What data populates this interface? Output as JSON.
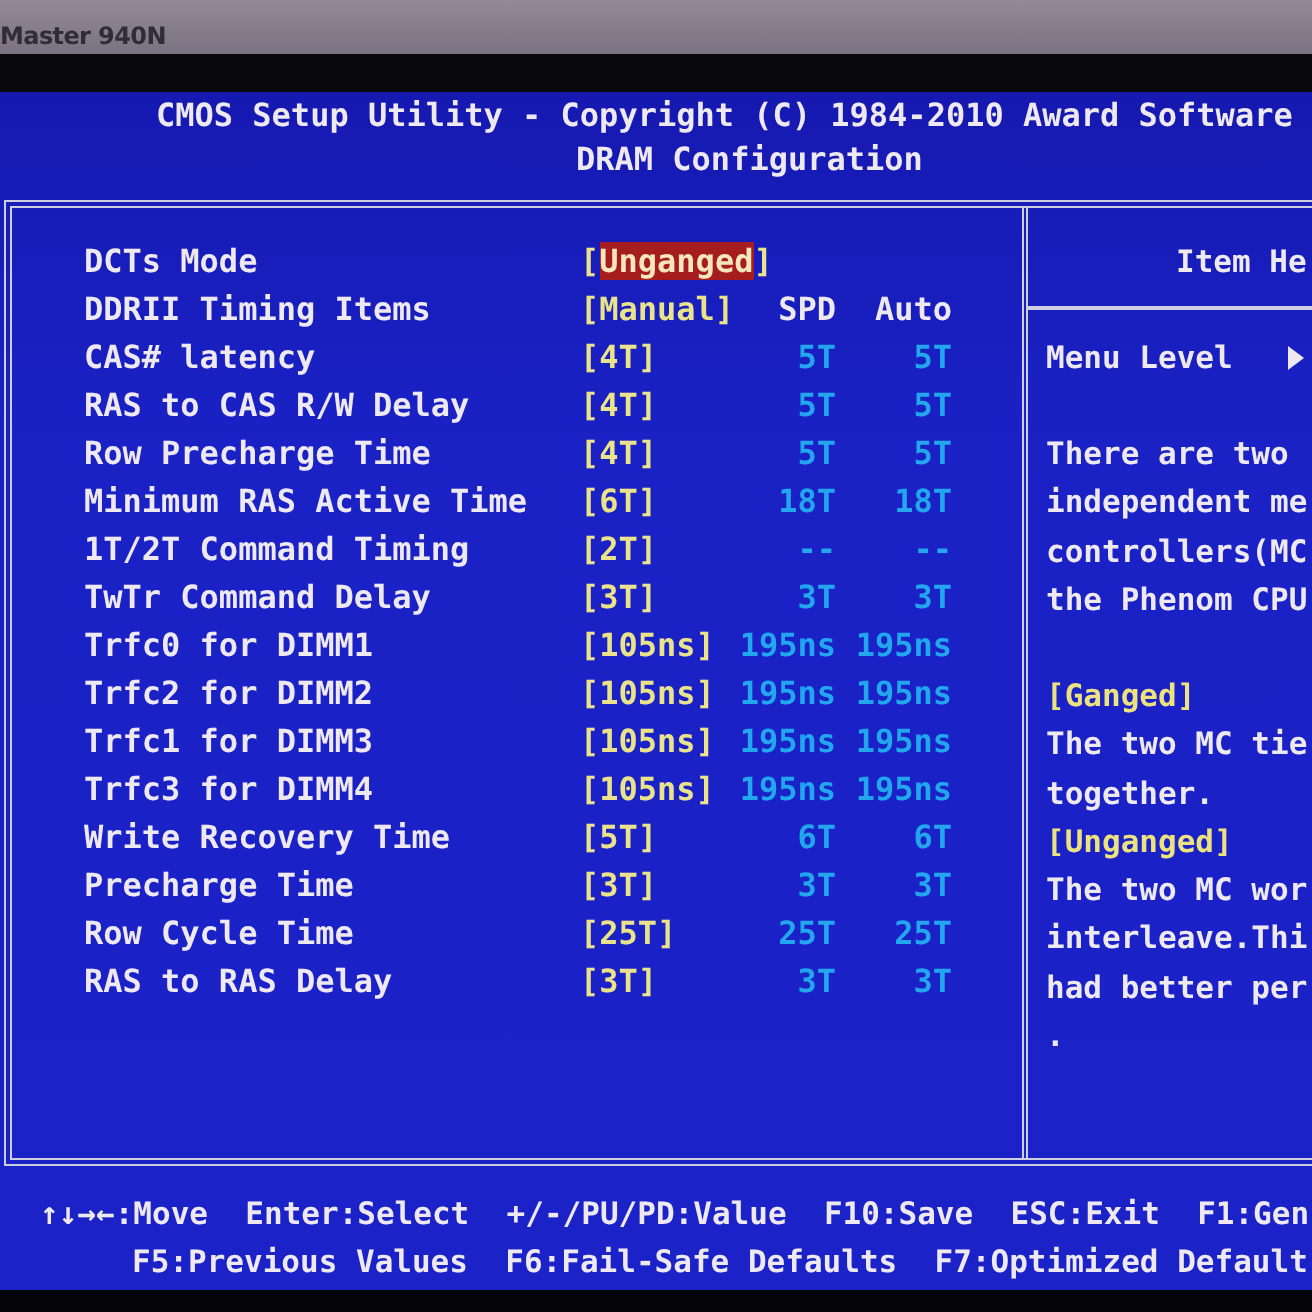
{
  "bezel": {
    "label": "Master 940N"
  },
  "header": {
    "title": "CMOS Setup Utility - Copyright (C) 1984-2010 Award Software",
    "subtitle": "DRAM Configuration"
  },
  "rows": [
    {
      "kind": "option",
      "label": "DCTs Mode",
      "value": "[Unganged]",
      "selected": true
    },
    {
      "kind": "heading",
      "label": "DDRII Timing Items",
      "value": "[Manual]",
      "spd": "SPD",
      "auto": "Auto",
      "selected": false
    },
    {
      "kind": "timing",
      "label": "CAS# latency",
      "value": "[4T]",
      "spd": "5T",
      "auto": "5T",
      "selected": false
    },
    {
      "kind": "timing",
      "label": "RAS to CAS R/W Delay",
      "value": "[4T]",
      "spd": "5T",
      "auto": "5T",
      "selected": false
    },
    {
      "kind": "timing",
      "label": "Row Precharge Time",
      "value": "[4T]",
      "spd": "5T",
      "auto": "5T",
      "selected": false
    },
    {
      "kind": "timing",
      "label": "Minimum RAS Active Time",
      "value": "[6T]",
      "spd": "18T",
      "auto": "18T",
      "selected": false
    },
    {
      "kind": "timing",
      "label": "1T/2T Command Timing",
      "value": "[2T]",
      "spd": "--",
      "auto": "--",
      "selected": false
    },
    {
      "kind": "timing",
      "label": "TwTr Command Delay",
      "value": "[3T]",
      "spd": "3T",
      "auto": "3T",
      "selected": false
    },
    {
      "kind": "timing",
      "label": "Trfc0 for DIMM1",
      "value": "[105ns]",
      "spd": "195ns",
      "auto": "195ns",
      "selected": false
    },
    {
      "kind": "timing",
      "label": "Trfc2 for DIMM2",
      "value": "[105ns]",
      "spd": "195ns",
      "auto": "195ns",
      "selected": false
    },
    {
      "kind": "timing",
      "label": "Trfc1 for DIMM3",
      "value": "[105ns]",
      "spd": "195ns",
      "auto": "195ns",
      "selected": false
    },
    {
      "kind": "timing",
      "label": "Trfc3 for DIMM4",
      "value": "[105ns]",
      "spd": "195ns",
      "auto": "195ns",
      "selected": false
    },
    {
      "kind": "timing",
      "label": "Write Recovery Time",
      "value": "[5T]",
      "spd": "6T",
      "auto": "6T",
      "selected": false
    },
    {
      "kind": "timing",
      "label": "Precharge Time",
      "value": "[3T]",
      "spd": "3T",
      "auto": "3T",
      "selected": false
    },
    {
      "kind": "timing",
      "label": "Row Cycle Time",
      "value": "[25T]",
      "spd": "25T",
      "auto": "25T",
      "selected": false
    },
    {
      "kind": "timing",
      "label": "RAS to RAS Delay",
      "value": "[3T]",
      "spd": "3T",
      "auto": "3T",
      "selected": false
    }
  ],
  "help": {
    "title": "Item He",
    "menu_level": "Menu Level",
    "blocks": [
      {
        "lines": [
          {
            "kind": "text",
            "text": "There are two"
          },
          {
            "kind": "text",
            "text": "independent me"
          },
          {
            "kind": "text",
            "text": "controllers(MC"
          },
          {
            "kind": "text",
            "text": "the Phenom CPU"
          }
        ]
      },
      {
        "lines": [
          {
            "kind": "option",
            "text": "[Ganged]"
          },
          {
            "kind": "text",
            "text": "The two MC tie"
          },
          {
            "kind": "text",
            "text": "together."
          },
          {
            "kind": "option",
            "text": "[Unganged]"
          },
          {
            "kind": "text",
            "text": "The two MC wor"
          },
          {
            "kind": "text",
            "text": "interleave.Thi"
          },
          {
            "kind": "text",
            "text": "had better per"
          },
          {
            "kind": "text",
            "text": "."
          }
        ]
      }
    ]
  },
  "footer": {
    "lines": [
      {
        "hints": [
          "↑↓→←:Move",
          "Enter:Select",
          "+/-/PU/PD:Value",
          "F10:Save",
          "ESC:Exit",
          "F1:Gen"
        ]
      },
      {
        "hints": [
          "F5:Previous Values",
          "F6:Fail-Safe Defaults",
          "F7:Optimized Default"
        ]
      }
    ]
  }
}
